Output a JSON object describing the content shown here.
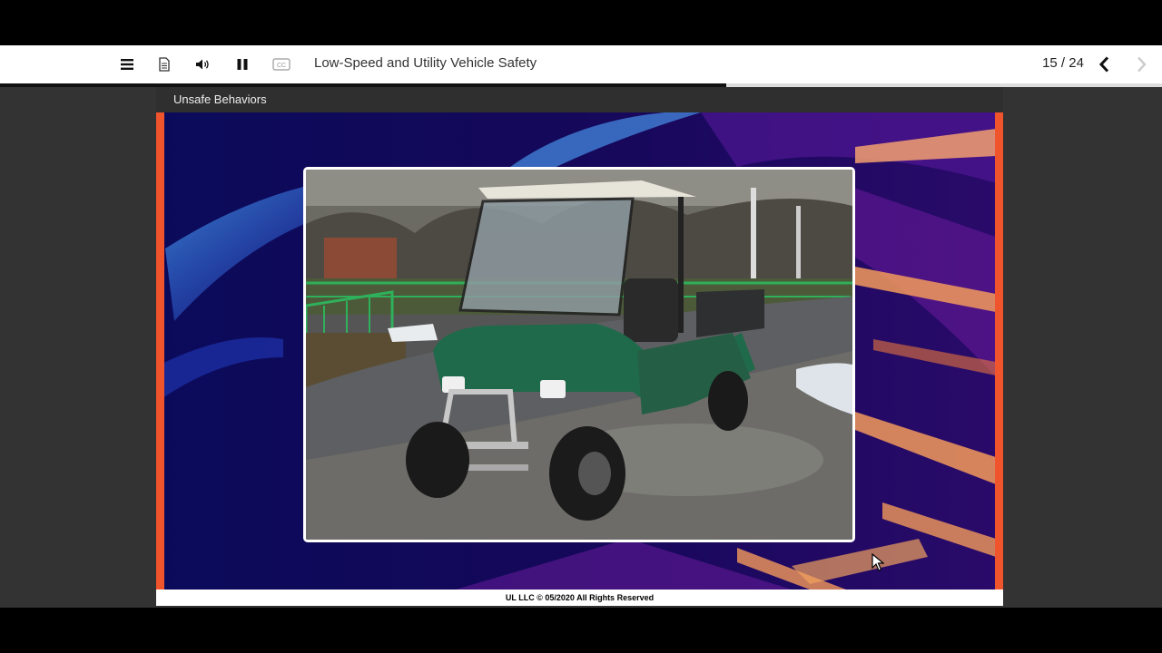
{
  "toolbar": {
    "menu_icon": "hamburger-menu-icon",
    "transcript_icon": "document-icon",
    "audio_icon": "speaker-volume-icon",
    "pause_icon": "pause-icon",
    "cc_icon": "closed-captions-icon",
    "cc_label": "CC",
    "title": "Low-Speed and Utility Vehicle Safety",
    "page_counter": "15 / 24",
    "prev_icon": "chevron-left-icon",
    "next_icon": "chevron-right-icon"
  },
  "progress": {
    "fraction": 0.625
  },
  "slide": {
    "section_title": "Unsafe Behaviors",
    "photo_subject": "green utility vehicle parked on a wet street",
    "footer": "UL LLC © 05/2020 All Rights Reserved"
  },
  "colors": {
    "slide_border_accent": "#f0542d",
    "slide_background": "#10074a",
    "vehicle_body": "#1f6a4a"
  }
}
